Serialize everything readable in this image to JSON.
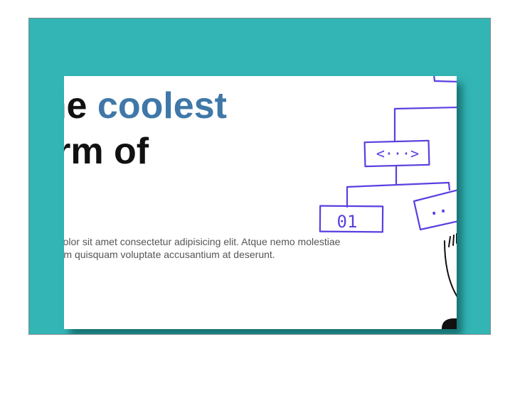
{
  "hero": {
    "headline_line1_start": "The ",
    "headline_accent": "coolest",
    "headline_line2": "form of",
    "lead_line1": "Lorem ipsum dolor sit amet consectetur adipisicing elit. Atque nemo molestiae",
    "lead_line2": "voluptas, veniam quisquam voluptate accusantium at deserunt."
  },
  "illustration": {
    "node_tag_label": "<···>",
    "node_binary_label": "01",
    "node_dots_label": "··",
    "stroke_color": "#5b3fe0"
  },
  "colors": {
    "frame_background": "#33b5b6",
    "accent": "#3f78a8",
    "heading": "#111111",
    "body_text": "#555555"
  }
}
